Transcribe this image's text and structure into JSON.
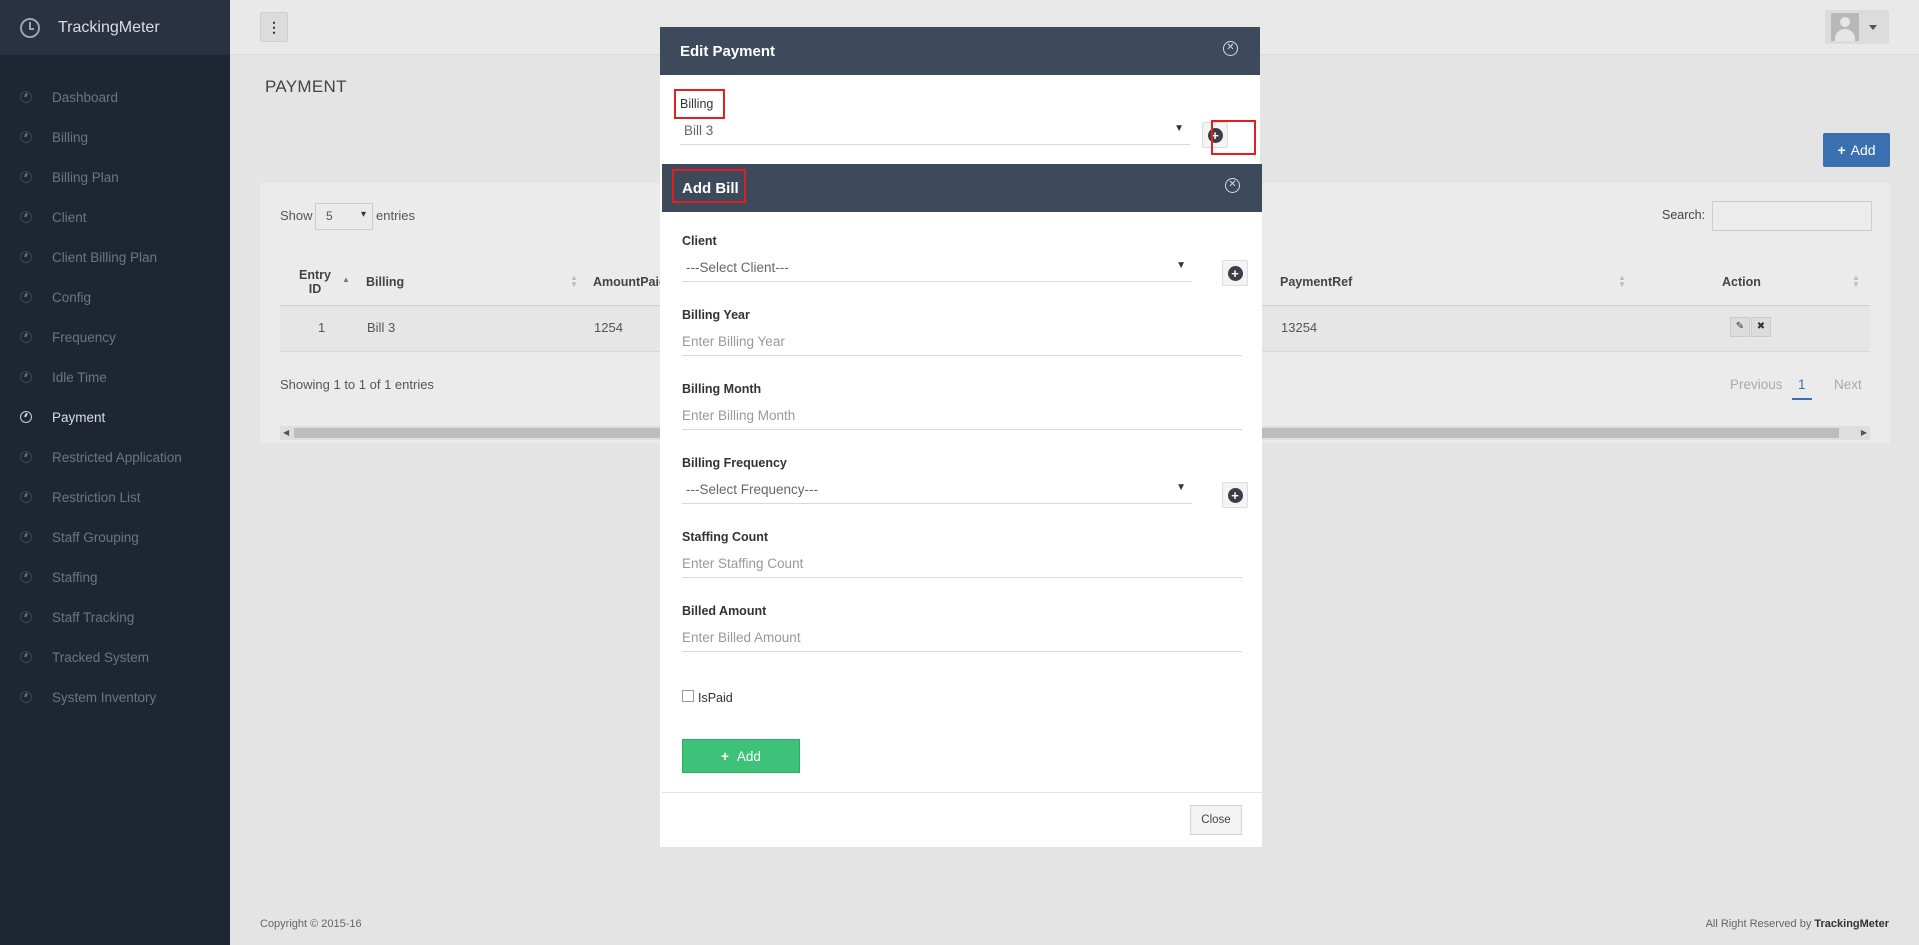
{
  "brand": {
    "name": "TrackingMeter"
  },
  "sidebar": {
    "items": [
      {
        "label": "Dashboard"
      },
      {
        "label": "Billing"
      },
      {
        "label": "Billing Plan"
      },
      {
        "label": "Client"
      },
      {
        "label": "Client Billing Plan"
      },
      {
        "label": "Config"
      },
      {
        "label": "Frequency"
      },
      {
        "label": "Idle Time"
      },
      {
        "label": "Payment",
        "active": true
      },
      {
        "label": "Restricted Application"
      },
      {
        "label": "Restriction List"
      },
      {
        "label": "Staff Grouping"
      },
      {
        "label": "Staffing"
      },
      {
        "label": "Staff Tracking"
      },
      {
        "label": "Tracked System"
      },
      {
        "label": "System Inventory"
      }
    ]
  },
  "page": {
    "title": "PAYMENT",
    "add_label": "Add",
    "show_label": "Show",
    "entries_value": "5",
    "entries_label": "entries",
    "search_label": "Search:",
    "columns": [
      "Entry ID",
      "Billing",
      "AmountPaid",
      "PaymentRef",
      "Action"
    ],
    "rows": [
      {
        "id": "1",
        "billing": "Bill 3",
        "amount": "1254",
        "ref": "13254"
      }
    ],
    "info": "Showing 1 to 1 of 1 entries",
    "pagination": {
      "previous": "Previous",
      "current": "1",
      "next": "Next"
    }
  },
  "edit_modal": {
    "title": "Edit Payment",
    "billing_label": "Billing",
    "billing_value": "Bill 3"
  },
  "add_modal": {
    "title": "Add Bill",
    "client_label": "Client",
    "client_value": "---Select Client---",
    "year_label": "Billing Year",
    "year_placeholder": "Enter Billing Year",
    "month_label": "Billing Month",
    "month_placeholder": "Enter Billing Month",
    "freq_label": "Billing Frequency",
    "freq_value": "---Select Frequency---",
    "staff_label": "Staffing Count",
    "staff_placeholder": "Enter Staffing Count",
    "amount_label": "Billed Amount",
    "amount_placeholder": "Enter Billed Amount",
    "ispaid_label": "IsPaid",
    "add_button": "Add",
    "close_button": "Close"
  },
  "footer": {
    "copyright": "Copyright © 2015-16",
    "rights_prefix": "All Right Reserved by",
    "rights_brand": "TrackingMeter"
  },
  "colors": {
    "sidebar": "#1f2633",
    "modal_header": "#3d4a5c",
    "primary": "#3a6fb0",
    "success": "#3ec178",
    "highlight": "#e02020"
  }
}
